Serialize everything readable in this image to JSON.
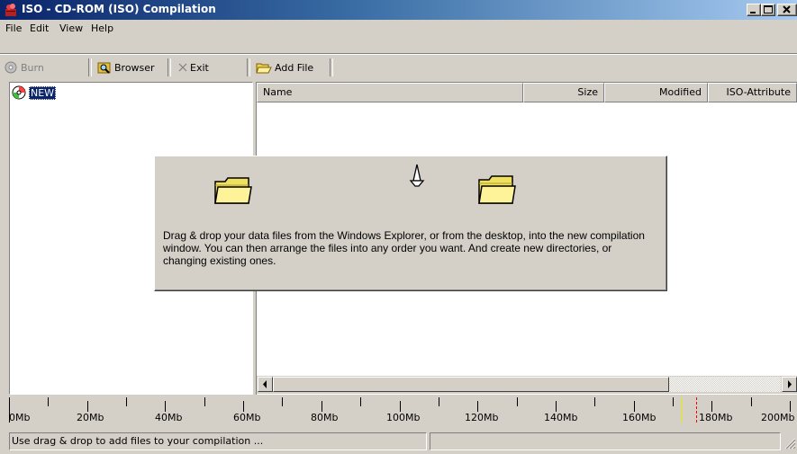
{
  "window": {
    "title": "ISO - CD-ROM (ISO) Compilation",
    "controls": {
      "minimize": "_",
      "maximize": "□",
      "close": "×"
    }
  },
  "menu": [
    "File",
    "Edit",
    "View",
    "Help"
  ],
  "toolbar": {
    "burn": "Burn",
    "browser": "Browser",
    "exit": "Exit",
    "add_file": "Add File"
  },
  "tree": {
    "root_label": "NEW"
  },
  "list": {
    "columns": [
      "Name",
      "Size",
      "Modified",
      "ISO-Attribute"
    ],
    "rows": []
  },
  "hint": {
    "text": "Drag & drop your data files from the Windows Explorer, or from the desktop, into the new compilation window. You can then arrange the files into any order you want.  And create new directories, or changing existing ones."
  },
  "ruler": {
    "labels": [
      "0Mb",
      "20Mb",
      "40Mb",
      "60Mb",
      "80Mb",
      "100Mb",
      "120Mb",
      "140Mb",
      "160Mb",
      "180Mb",
      "200Mb"
    ],
    "marker_color": "#ff0000",
    "limit_color": "#e8e800"
  },
  "status": {
    "main": "Use drag & drop to add files to your compilation ...",
    "secondary": ""
  },
  "colors": {
    "title_start": "#0a246a",
    "title_end": "#a6caf0",
    "face": "#d4d0c8",
    "selection": "#0a246a"
  }
}
